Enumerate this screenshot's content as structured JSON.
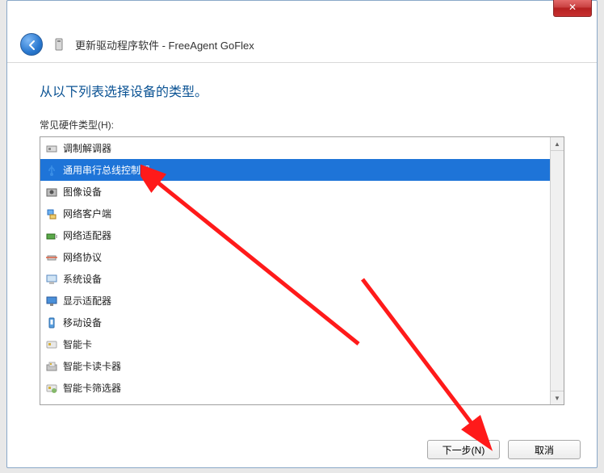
{
  "window": {
    "title": "更新驱动程序软件 - FreeAgent GoFlex",
    "close_label": "✕"
  },
  "content": {
    "heading": "从以下列表选择设备的类型。",
    "list_label": "常见硬件类型(H):"
  },
  "hardware_list": [
    {
      "icon": "modem-icon",
      "label": "调制解调器",
      "selected": false
    },
    {
      "icon": "usb-icon",
      "label": "通用串行总线控制器",
      "selected": true
    },
    {
      "icon": "imaging-icon",
      "label": "图像设备",
      "selected": false
    },
    {
      "icon": "network-client-icon",
      "label": "网络客户端",
      "selected": false
    },
    {
      "icon": "network-adapter-icon",
      "label": "网络适配器",
      "selected": false
    },
    {
      "icon": "protocol-icon",
      "label": "网络协议",
      "selected": false
    },
    {
      "icon": "system-icon",
      "label": "系统设备",
      "selected": false
    },
    {
      "icon": "display-icon",
      "label": "显示适配器",
      "selected": false
    },
    {
      "icon": "mobile-icon",
      "label": "移动设备",
      "selected": false
    },
    {
      "icon": "smartcard-icon",
      "label": "智能卡",
      "selected": false
    },
    {
      "icon": "smartcard-reader-icon",
      "label": "智能卡读卡器",
      "selected": false
    },
    {
      "icon": "smartcard-filter-icon",
      "label": "智能卡筛选器",
      "selected": false
    }
  ],
  "footer": {
    "next_label": "下一步(N)",
    "cancel_label": "取消"
  }
}
